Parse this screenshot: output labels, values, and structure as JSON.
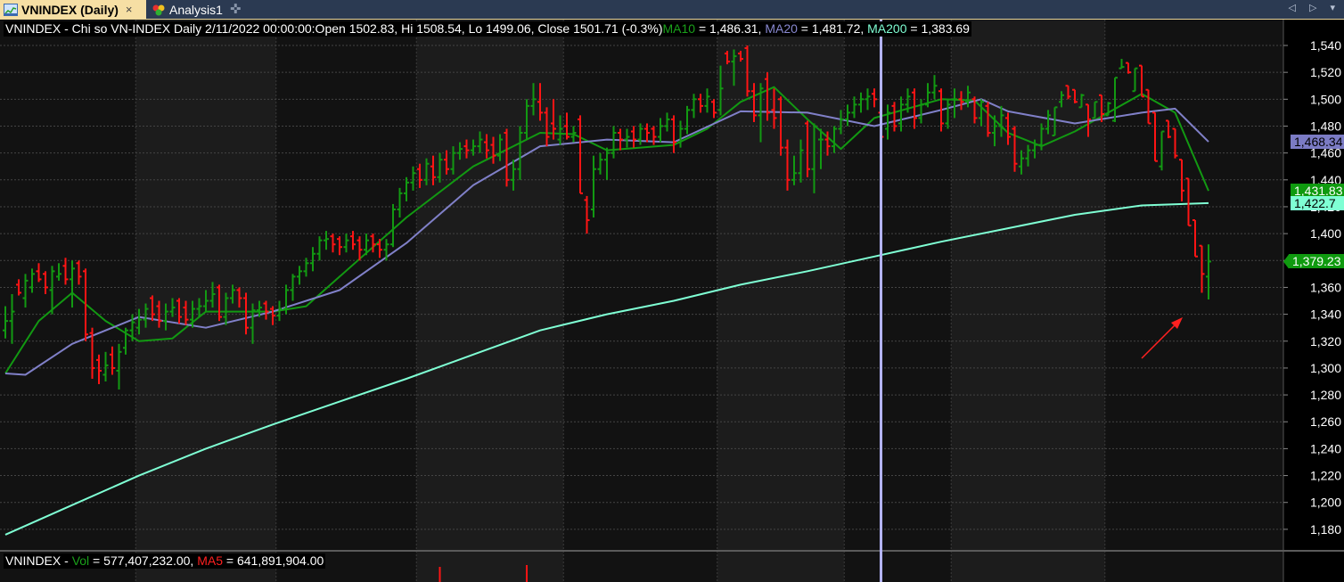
{
  "tabs": [
    {
      "label": "VNINDEX (Daily)",
      "close": "×",
      "icon": "chart-icon"
    },
    {
      "label": "Analysis1",
      "icon": "analysis-icon"
    }
  ],
  "add_tab_icon": "✜",
  "nav_arrows": "◁ ▷ ▾",
  "header": {
    "prefix": "VNINDEX - Chi so VN-INDEX  Daily 2/11/2022 00:00:00:Open 1502.83, Hi 1508.54, Lo 1499.06, Close 1501.71 (-0.3%)",
    "ma10_label": "MA10",
    "ma10_value": " = 1,486.31, ",
    "ma20_label": "MA20",
    "ma20_value": " = 1,481.72, ",
    "ma200_label": "MA200",
    "ma200_value": " = 1,383.69"
  },
  "volume_header": {
    "prefix": "VNINDEX - ",
    "vol_label": "Vol",
    "vol_value": " = 577,407,232.00, ",
    "ma5_label": "MA5",
    "ma5_value": " = 641,891,904.00"
  },
  "price_tags": [
    {
      "text": "1,468.34",
      "value": 1468.34,
      "bg": "#7b7bc4",
      "fg": "#000000",
      "name": "ma20-last-tag"
    },
    {
      "text": "1,431.83",
      "value": 1431.83,
      "bg": "#0f9a0f",
      "fg": "#ffffff",
      "name": "ma10-last-tag"
    },
    {
      "text": "1,422.7",
      "value": 1422.7,
      "bg": "#7fffd4",
      "fg": "#000000",
      "name": "ma200-last-tag"
    },
    {
      "text": "1,379.23",
      "value": 1379.23,
      "bg": "#0f9a0f",
      "fg": "#ffffff",
      "name": "close-last-tag"
    }
  ],
  "colors": {
    "up": "#129912",
    "down": "#ff1414",
    "ma10": "#129912",
    "ma20": "#8080c8",
    "ma200": "#7fffd4",
    "cursor": "#b4b4ff",
    "arrow": "#ff2020"
  },
  "chart_data": {
    "type": "ohlc",
    "title": "VNINDEX - Chi so VN-INDEX Daily",
    "ylim": [
      1170,
      1550
    ],
    "yticks": [
      1180,
      1200,
      1220,
      1240,
      1260,
      1280,
      1300,
      1320,
      1340,
      1360,
      1380,
      1400,
      1420,
      1440,
      1460,
      1480,
      1500,
      1520,
      1540
    ],
    "ytick_labels": [
      "1,180",
      "1,200",
      "1,220",
      "1,240",
      "1,260",
      "1,280",
      "1,300",
      "1,320",
      "1,340",
      "1,360",
      "1,380",
      "1,400",
      "1,420",
      "1,440",
      "1,460",
      "1,480",
      "1,500",
      "1,520",
      "1,540"
    ],
    "grid": true,
    "cursor_bar": 131,
    "bars_ohlc": [
      [
        1328,
        1346,
        1322,
        1335
      ],
      [
        1335,
        1355,
        1318,
        1342
      ],
      [
        1362,
        1366,
        1354,
        1356
      ],
      [
        1352,
        1370,
        1345,
        1365
      ],
      [
        1360,
        1374,
        1356,
        1370
      ],
      [
        1372,
        1378,
        1364,
        1366
      ],
      [
        1370,
        1372,
        1355,
        1360
      ],
      [
        1358,
        1376,
        1340,
        1372
      ],
      [
        1368,
        1378,
        1365,
        1370
      ],
      [
        1376,
        1382,
        1362,
        1366
      ],
      [
        1366,
        1380,
        1345,
        1374
      ],
      [
        1378,
        1380,
        1362,
        1368
      ],
      [
        1372,
        1374,
        1320,
        1325
      ],
      [
        1326,
        1330,
        1292,
        1300
      ],
      [
        1306,
        1310,
        1288,
        1298
      ],
      [
        1295,
        1312,
        1290,
        1302
      ],
      [
        1310,
        1316,
        1295,
        1300
      ],
      [
        1298,
        1318,
        1284,
        1312
      ],
      [
        1315,
        1330,
        1310,
        1328
      ],
      [
        1328,
        1340,
        1320,
        1334
      ],
      [
        1330,
        1344,
        1325,
        1336
      ],
      [
        1336,
        1348,
        1330,
        1344
      ],
      [
        1352,
        1354,
        1335,
        1340
      ],
      [
        1346,
        1350,
        1330,
        1335
      ],
      [
        1335,
        1348,
        1328,
        1342
      ],
      [
        1342,
        1352,
        1338,
        1345
      ],
      [
        1350,
        1352,
        1333,
        1338
      ],
      [
        1345,
        1350,
        1332,
        1336
      ],
      [
        1336,
        1350,
        1330,
        1344
      ],
      [
        1344,
        1352,
        1338,
        1346
      ],
      [
        1346,
        1358,
        1342,
        1350
      ],
      [
        1350,
        1364,
        1345,
        1355
      ],
      [
        1360,
        1362,
        1335,
        1338
      ],
      [
        1338,
        1356,
        1332,
        1352
      ],
      [
        1352,
        1362,
        1348,
        1358
      ],
      [
        1358,
        1360,
        1345,
        1352
      ],
      [
        1352,
        1356,
        1325,
        1330
      ],
      [
        1330,
        1348,
        1318,
        1343
      ],
      [
        1343,
        1350,
        1338,
        1345
      ],
      [
        1348,
        1350,
        1336,
        1342
      ],
      [
        1344,
        1346,
        1332,
        1339
      ],
      [
        1339,
        1350,
        1335,
        1344
      ],
      [
        1344,
        1362,
        1340,
        1358
      ],
      [
        1358,
        1370,
        1350,
        1368
      ],
      [
        1368,
        1376,
        1362,
        1372
      ],
      [
        1372,
        1382,
        1368,
        1378
      ],
      [
        1378,
        1390,
        1372,
        1385
      ],
      [
        1385,
        1398,
        1380,
        1395
      ],
      [
        1395,
        1402,
        1388,
        1396
      ],
      [
        1398,
        1400,
        1386,
        1392
      ],
      [
        1396,
        1398,
        1384,
        1390
      ],
      [
        1390,
        1400,
        1386,
        1395
      ],
      [
        1398,
        1402,
        1388,
        1392
      ],
      [
        1395,
        1398,
        1380,
        1388
      ],
      [
        1388,
        1400,
        1384,
        1395
      ],
      [
        1398,
        1400,
        1386,
        1392
      ],
      [
        1392,
        1396,
        1382,
        1388
      ],
      [
        1388,
        1396,
        1380,
        1392
      ],
      [
        1392,
        1422,
        1390,
        1418
      ],
      [
        1418,
        1434,
        1412,
        1430
      ],
      [
        1430,
        1442,
        1424,
        1438
      ],
      [
        1438,
        1450,
        1432,
        1445
      ],
      [
        1448,
        1452,
        1434,
        1440
      ],
      [
        1440,
        1456,
        1436,
        1452
      ],
      [
        1450,
        1458,
        1436,
        1442
      ],
      [
        1442,
        1460,
        1438,
        1455
      ],
      [
        1455,
        1462,
        1444,
        1448
      ],
      [
        1448,
        1465,
        1444,
        1460
      ],
      [
        1460,
        1468,
        1455,
        1463
      ],
      [
        1465,
        1470,
        1456,
        1462
      ],
      [
        1462,
        1470,
        1458,
        1465
      ],
      [
        1465,
        1476,
        1460,
        1470
      ],
      [
        1468,
        1474,
        1456,
        1462
      ],
      [
        1466,
        1472,
        1452,
        1458
      ],
      [
        1458,
        1474,
        1454,
        1470
      ],
      [
        1475,
        1478,
        1435,
        1440
      ],
      [
        1440,
        1455,
        1432,
        1448
      ],
      [
        1448,
        1480,
        1440,
        1475
      ],
      [
        1475,
        1500,
        1470,
        1495
      ],
      [
        1495,
        1512,
        1488,
        1500
      ],
      [
        1498,
        1512,
        1484,
        1490
      ],
      [
        1490,
        1494,
        1465,
        1472
      ],
      [
        1482,
        1500,
        1470,
        1478
      ],
      [
        1470,
        1488,
        1466,
        1478
      ],
      [
        1480,
        1490,
        1470,
        1472
      ],
      [
        1472,
        1480,
        1468,
        1475
      ],
      [
        1485,
        1488,
        1430,
        1430
      ],
      [
        1425,
        1428,
        1400,
        1410
      ],
      [
        1418,
        1458,
        1412,
        1448
      ],
      [
        1448,
        1460,
        1444,
        1455
      ],
      [
        1455,
        1464,
        1440,
        1460
      ],
      [
        1460,
        1480,
        1456,
        1475
      ],
      [
        1475,
        1478,
        1462,
        1470
      ],
      [
        1470,
        1478,
        1464,
        1472
      ],
      [
        1476,
        1480,
        1464,
        1470
      ],
      [
        1470,
        1482,
        1466,
        1478
      ],
      [
        1478,
        1482,
        1468,
        1475
      ],
      [
        1478,
        1480,
        1466,
        1472
      ],
      [
        1472,
        1486,
        1468,
        1480
      ],
      [
        1480,
        1490,
        1476,
        1485
      ],
      [
        1485,
        1488,
        1460,
        1468
      ],
      [
        1468,
        1484,
        1464,
        1478
      ],
      [
        1478,
        1495,
        1474,
        1492
      ],
      [
        1492,
        1504,
        1486,
        1500
      ],
      [
        1500,
        1504,
        1490,
        1495
      ],
      [
        1495,
        1508,
        1490,
        1502
      ],
      [
        1498,
        1500,
        1486,
        1490
      ],
      [
        1492,
        1525,
        1488,
        1508
      ],
      [
        1534,
        1536,
        1526,
        1528
      ],
      [
        1528,
        1537,
        1510,
        1532
      ],
      [
        1534,
        1536,
        1528,
        1530
      ],
      [
        1538,
        1540,
        1502,
        1506
      ],
      [
        1506,
        1512,
        1483,
        1488
      ],
      [
        1488,
        1512,
        1468,
        1508
      ],
      [
        1515,
        1520,
        1484,
        1490
      ],
      [
        1492,
        1508,
        1478,
        1486
      ],
      [
        1500,
        1502,
        1458,
        1464
      ],
      [
        1464,
        1470,
        1432,
        1440
      ],
      [
        1440,
        1458,
        1436,
        1445
      ],
      [
        1445,
        1470,
        1438,
        1462
      ],
      [
        1482,
        1484,
        1442,
        1448
      ],
      [
        1448,
        1482,
        1430,
        1480
      ],
      [
        1470,
        1478,
        1448,
        1470
      ],
      [
        1470,
        1476,
        1458,
        1465
      ],
      [
        1465,
        1480,
        1460,
        1478
      ],
      [
        1478,
        1492,
        1474,
        1485
      ],
      [
        1485,
        1496,
        1480,
        1490
      ],
      [
        1490,
        1502,
        1486,
        1496
      ],
      [
        1496,
        1505,
        1490,
        1500
      ],
      [
        1500,
        1508,
        1492,
        1502
      ],
      [
        1504,
        1508,
        1494,
        1500
      ],
      [
        1490,
        1492,
        1470,
        1472
      ],
      [
        1478,
        1496,
        1470,
        1490
      ],
      [
        1495,
        1498,
        1476,
        1480
      ],
      [
        1482,
        1502,
        1476,
        1496
      ],
      [
        1496,
        1508,
        1490,
        1502
      ],
      [
        1505,
        1508,
        1478,
        1486
      ],
      [
        1486,
        1500,
        1482,
        1496
      ],
      [
        1496,
        1512,
        1494,
        1505
      ],
      [
        1505,
        1518,
        1500,
        1510
      ],
      [
        1506,
        1508,
        1476,
        1482
      ],
      [
        1482,
        1500,
        1478,
        1496
      ],
      [
        1500,
        1508,
        1486,
        1500
      ],
      [
        1500,
        1506,
        1492,
        1498
      ],
      [
        1498,
        1510,
        1494,
        1505
      ],
      [
        1500,
        1502,
        1482,
        1486
      ],
      [
        1486,
        1500,
        1480,
        1498
      ],
      [
        1495,
        1498,
        1472,
        1475
      ],
      [
        1475,
        1488,
        1465,
        1480
      ],
      [
        1480,
        1495,
        1472,
        1488
      ],
      [
        1486,
        1490,
        1466,
        1472
      ],
      [
        1478,
        1480,
        1446,
        1452
      ],
      [
        1450,
        1462,
        1444,
        1456
      ],
      [
        1456,
        1466,
        1450,
        1462
      ],
      [
        1462,
        1470,
        1456,
        1466
      ],
      [
        1466,
        1482,
        1462,
        1478
      ],
      [
        1478,
        1492,
        1474,
        1488
      ],
      [
        1473,
        1494,
        1473,
        1494
      ],
      [
        1498,
        1506,
        1494,
        1503
      ],
      [
        1510,
        1510,
        1500,
        1502
      ],
      [
        1507,
        1507,
        1497,
        1498
      ],
      [
        1494,
        1504,
        1494,
        1503
      ],
      [
        1496,
        1496,
        1472,
        1485
      ],
      [
        1486,
        1498,
        1486,
        1498
      ],
      [
        1503,
        1503,
        1483,
        1489
      ],
      [
        1488,
        1498,
        1488,
        1497
      ],
      [
        1484,
        1516,
        1483,
        1516
      ],
      [
        1523,
        1530,
        1523,
        1524
      ],
      [
        1527,
        1527,
        1519,
        1520
      ],
      [
        1506,
        1523,
        1506,
        1523
      ],
      [
        1525,
        1525,
        1502,
        1502
      ],
      [
        1507,
        1507,
        1482,
        1482
      ],
      [
        1490,
        1490,
        1454,
        1454
      ],
      [
        1450,
        1476,
        1447,
        1476
      ],
      [
        1484,
        1484,
        1471,
        1472
      ],
      [
        1478,
        1478,
        1456,
        1458
      ],
      [
        1455,
        1455,
        1424,
        1432
      ],
      [
        1441,
        1441,
        1406,
        1406
      ],
      [
        1410,
        1410,
        1383,
        1383
      ],
      [
        1391,
        1391,
        1356,
        1370
      ],
      [
        1368,
        1392,
        1351,
        1379.23
      ]
    ],
    "series": [
      {
        "name": "MA10",
        "points": [
          [
            0,
            1296
          ],
          [
            5,
            1335
          ],
          [
            10,
            1356
          ],
          [
            15,
            1335
          ],
          [
            20,
            1320
          ],
          [
            25,
            1322
          ],
          [
            30,
            1342
          ],
          [
            40,
            1342
          ],
          [
            45,
            1346
          ],
          [
            50,
            1368
          ],
          [
            60,
            1412
          ],
          [
            70,
            1450
          ],
          [
            80,
            1475
          ],
          [
            85,
            1474
          ],
          [
            90,
            1462
          ],
          [
            100,
            1466
          ],
          [
            105,
            1478
          ],
          [
            110,
            1498
          ],
          [
            115,
            1509
          ],
          [
            120,
            1485
          ],
          [
            125,
            1463
          ],
          [
            130,
            1486
          ],
          [
            140,
            1500
          ],
          [
            145,
            1499
          ],
          [
            150,
            1475
          ],
          [
            155,
            1465
          ],
          [
            160,
            1476
          ],
          [
            165,
            1490
          ],
          [
            170,
            1504
          ],
          [
            175,
            1490
          ],
          [
            180,
            1431.83
          ]
        ]
      },
      {
        "name": "MA20",
        "points": [
          [
            0,
            1296
          ],
          [
            3,
            1295
          ],
          [
            10,
            1318
          ],
          [
            20,
            1338
          ],
          [
            30,
            1330
          ],
          [
            40,
            1342
          ],
          [
            50,
            1358
          ],
          [
            60,
            1393
          ],
          [
            70,
            1436
          ],
          [
            80,
            1465
          ],
          [
            90,
            1470
          ],
          [
            100,
            1468
          ],
          [
            110,
            1491
          ],
          [
            120,
            1490
          ],
          [
            130,
            1480
          ],
          [
            140,
            1492
          ],
          [
            146,
            1500
          ],
          [
            150,
            1491
          ],
          [
            160,
            1482
          ],
          [
            170,
            1490
          ],
          [
            175,
            1493
          ],
          [
            180,
            1468.34
          ]
        ]
      },
      {
        "name": "MA200",
        "points": [
          [
            0,
            1176
          ],
          [
            10,
            1198
          ],
          [
            20,
            1220
          ],
          [
            30,
            1240
          ],
          [
            40,
            1258
          ],
          [
            50,
            1275
          ],
          [
            60,
            1292
          ],
          [
            70,
            1310
          ],
          [
            80,
            1328
          ],
          [
            90,
            1340
          ],
          [
            100,
            1350
          ],
          [
            110,
            1362
          ],
          [
            120,
            1372
          ],
          [
            130,
            1383
          ],
          [
            140,
            1394
          ],
          [
            150,
            1404
          ],
          [
            160,
            1414
          ],
          [
            170,
            1421
          ],
          [
            180,
            1422.7
          ]
        ]
      }
    ],
    "month_bands_start_bars": [
      0,
      20,
      41,
      62,
      84,
      107,
      126,
      142,
      165
    ]
  }
}
